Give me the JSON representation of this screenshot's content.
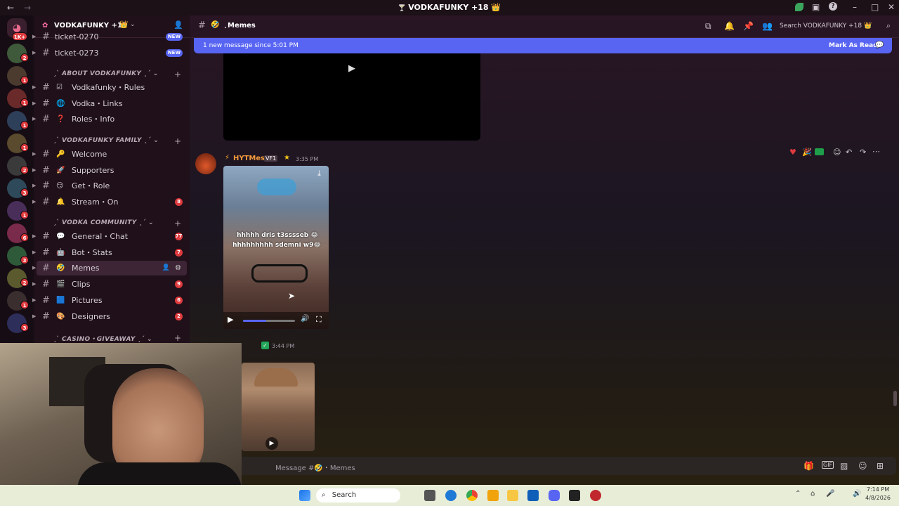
{
  "window": {
    "title": "VODKAFUNKY +18"
  },
  "server": {
    "name": "VODKAFUNKY +18",
    "notice_badge": "1K+"
  },
  "server_badges": [
    "2",
    "1",
    "1",
    "1",
    "1",
    "2",
    "3",
    "1",
    "6",
    "3",
    "2",
    "1",
    "3"
  ],
  "sidebar": {
    "top_channels": [
      {
        "name": "ticket-0270",
        "badge": "NEW"
      },
      {
        "name": "ticket-0273",
        "badge": "NEW"
      }
    ],
    "categories": [
      {
        "name": "ABOUT VODKAFUNKY",
        "channels": [
          {
            "emoji": "☑",
            "name": "Vodkafunky・Rules",
            "badge": ""
          },
          {
            "emoji": "🌐",
            "name": "Vodka・Links",
            "badge": ""
          },
          {
            "emoji": "❓",
            "name": "Roles・Info",
            "badge": ""
          }
        ]
      },
      {
        "name": "VODKAFUNKY FAMILY",
        "channels": [
          {
            "emoji": "🔑",
            "name": "Welcome",
            "badge": ""
          },
          {
            "emoji": "🚀",
            "name": "Supporters",
            "badge": ""
          },
          {
            "emoji": "😏",
            "name": "Get・Role",
            "badge": ""
          },
          {
            "emoji": "🔔",
            "name": "Stream・On",
            "badge": "8"
          }
        ]
      },
      {
        "name": "VODKA COMMUNITY",
        "channels": [
          {
            "emoji": "💬",
            "name": "General・Chat",
            "badge": "77"
          },
          {
            "emoji": "🤖",
            "name": "Bot・Stats",
            "badge": "7"
          },
          {
            "emoji": "🤣",
            "name": "Memes",
            "badge": ""
          },
          {
            "emoji": "🎬",
            "name": "Clips",
            "badge": "9"
          },
          {
            "emoji": "🟦",
            "name": "Pictures",
            "badge": "6"
          },
          {
            "emoji": "🎨",
            "name": "Designers",
            "badge": "2"
          }
        ]
      },
      {
        "name": "CASINO・GIVEAWAY",
        "channels": []
      }
    ]
  },
  "channel_header": {
    "name": "Memes",
    "search_placeholder": "Search VODKAFUNKY +18"
  },
  "new_messages_bar": {
    "text": "1 new message since 5:01 PM",
    "action": "Mark As Read"
  },
  "messages": [
    {
      "author": "HYTMes",
      "tag": "VF1",
      "time": "3:35 PM",
      "video_caption_1": "hhhhh dris t3sssseb 😂",
      "video_caption_2": "hhhhhhhhh sdemni w9😂"
    },
    {
      "author": "",
      "time": "3:44 PM"
    }
  ],
  "input": {
    "placeholder": "Message #🤣・Memes"
  },
  "taskbar": {
    "search": "Search",
    "time": "7:14 PM",
    "date": "4/8/2026"
  },
  "colors": {
    "accent": "#5865f2",
    "badge": "#e03a3e",
    "online": "#23a55a"
  }
}
